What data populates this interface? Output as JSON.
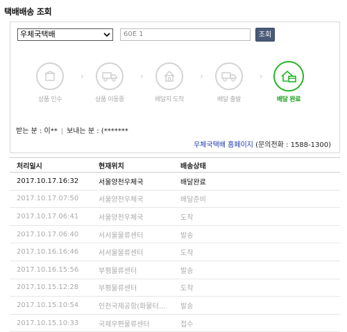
{
  "page_title": "택배배송 조회",
  "search": {
    "carrier": "우체국택배",
    "tracking_number": "60E          1",
    "button_label": "조회"
  },
  "steps": [
    {
      "label": "상품 인수",
      "icon": "box-icon",
      "active": false
    },
    {
      "label": "상품 이동중",
      "icon": "truck-icon",
      "active": false
    },
    {
      "label": "배달지 도착",
      "icon": "house-icon",
      "active": false
    },
    {
      "label": "배달 출발",
      "icon": "delivery-truck-icon",
      "active": false
    },
    {
      "label": "배달 완료",
      "icon": "house-package-icon",
      "active": true
    }
  ],
  "colors": {
    "active": "#25b325",
    "inactive": "#d3d3d3",
    "link": "#1a3aa8",
    "button": "#4a5a78"
  },
  "people": {
    "receiver": "받는 분 : 이**",
    "sender": "보내는 분 : (*******"
  },
  "homepage": {
    "link_text": "우체국택배 홈페이지",
    "phone_text": "(문의전화 : 1588-1300)"
  },
  "table": {
    "headers": [
      "처리일시",
      "현재위치",
      "배송상태"
    ],
    "rows": [
      [
        "2017.10.17.16:32",
        "서울양천우체국",
        "배달완료"
      ],
      [
        "2017.10.17.07:50",
        "서울양천우체국",
        "배달준비"
      ],
      [
        "2017.10.17.06:41",
        "서울양천우체국",
        "도착"
      ],
      [
        "2017.10.17.06:40",
        "서서울물류센터",
        "발송"
      ],
      [
        "2017.10.16.16:46",
        "서서울물류센터",
        "도착"
      ],
      [
        "2017.10.16.15:56",
        "부평물류센터",
        "발송"
      ],
      [
        "2017.10.15.12:28",
        "부평물류센터",
        "도착"
      ],
      [
        "2017.10.15.10:54",
        "인천국제공항(화물터…",
        "발송"
      ],
      [
        "2017.10.15.10:33",
        "국제우편물류센터",
        "접수"
      ]
    ]
  }
}
